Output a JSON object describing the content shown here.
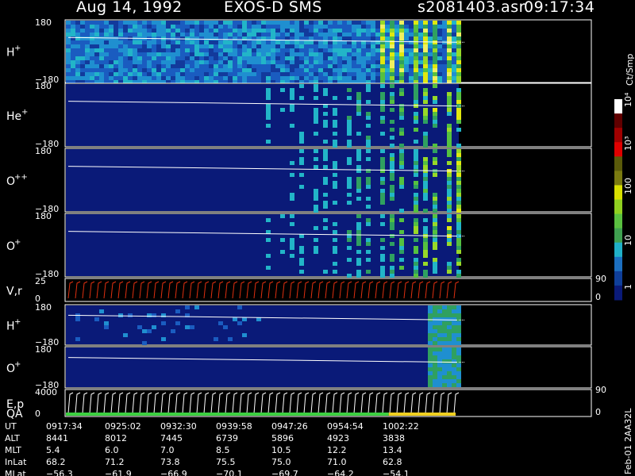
{
  "header": {
    "date": "Aug 14, 1992",
    "instrument": "EXOS-D SMS",
    "file": "s2081403.asr",
    "time": "09:17:34"
  },
  "footer": {
    "side_code": "Feb-01 2AA32L",
    "rows": [
      {
        "label": "UT",
        "values": [
          "0917:34",
          "0925:02",
          "0932:30",
          "0939:58",
          "0947:26",
          "0954:54",
          "1002:22"
        ]
      },
      {
        "label": "ALT",
        "values": [
          "8441",
          "8012",
          "7445",
          "6739",
          "5896",
          "4923",
          "3838"
        ]
      },
      {
        "label": "MLT",
        "values": [
          "5.4",
          "6.0",
          "7.0",
          "8.5",
          "10.5",
          "12.2",
          "13.4"
        ]
      },
      {
        "label": "InLat",
        "values": [
          "68.2",
          "71.2",
          "73.8",
          "75.5",
          "75.0",
          "71.0",
          "62.8"
        ]
      },
      {
        "label": "MLat",
        "values": [
          "−56.3",
          "−61.9",
          "−66.9",
          "−70.1",
          "−69.7",
          "−64.2",
          "−54.1"
        ]
      }
    ]
  },
  "colorbar": {
    "unit": "Ct/Smp",
    "tick_labels": [
      "1",
      "10",
      "100",
      "10³",
      "10⁴"
    ],
    "colors": [
      "#0a1a78",
      "#0f3f9a",
      "#1c6fc0",
      "#20b0c8",
      "#3fa050",
      "#5ac040",
      "#90d020",
      "#d8e000",
      "#7a7a10",
      "#5a5a0a",
      "#e00000",
      "#a00000",
      "#600000",
      "#ffffff"
    ]
  },
  "chart_data": [
    {
      "type": "heatmap",
      "name": "H",
      "superscript": "+",
      "ylim": [
        -180,
        180
      ],
      "ytick_labels": [
        "180",
        "−180"
      ],
      "background": "#0f2f8a",
      "activity": "high_throughout",
      "bursts_start_fraction": 0.78
    },
    {
      "type": "heatmap",
      "name": "He",
      "superscript": "+",
      "ylim": [
        -180,
        180
      ],
      "ytick_labels": [
        "180",
        "−180"
      ],
      "background": "#0a1a78",
      "activity": "bursts_late",
      "bursts_start_fraction": 0.5
    },
    {
      "type": "heatmap",
      "name": "O",
      "superscript": "++",
      "ylim": [
        -180,
        180
      ],
      "ytick_labels": [
        "180",
        "−180"
      ],
      "background": "#0a1a78",
      "activity": "bursts_late",
      "bursts_start_fraction": 0.55
    },
    {
      "type": "heatmap",
      "name": "O",
      "superscript": "+",
      "ylim": [
        -180,
        180
      ],
      "ytick_labels": [
        "180",
        "−180"
      ],
      "background": "#0a1a78",
      "activity": "bursts_late",
      "bursts_start_fraction": 0.5
    },
    {
      "type": "line",
      "name": "V,r",
      "ylim": [
        0,
        25
      ],
      "ytick_labels": [
        "25",
        "0"
      ],
      "right_tick_labels": [
        "90",
        "0"
      ],
      "color": "#e03010"
    },
    {
      "type": "heatmap",
      "name": "H",
      "superscript": "+",
      "ylim": [
        -180,
        180
      ],
      "ytick_labels": [
        "180",
        "−180"
      ],
      "background": "#0a1a78",
      "activity": "sparse_then_green_end"
    },
    {
      "type": "heatmap",
      "name": "O",
      "superscript": "+",
      "ylim": [
        -180,
        180
      ],
      "ytick_labels": [
        "180",
        "−180"
      ],
      "background": "#0a1a78",
      "activity": "green_end"
    },
    {
      "type": "line",
      "name": "E,p",
      "second_name": "QA",
      "ylim": [
        0,
        4000
      ],
      "ytick_labels": [
        "4000",
        "0"
      ],
      "right_tick_labels": [
        "90",
        "0"
      ],
      "color": "#ffffff",
      "qa_colors": [
        "#3cd040",
        "#f0d020"
      ]
    }
  ]
}
